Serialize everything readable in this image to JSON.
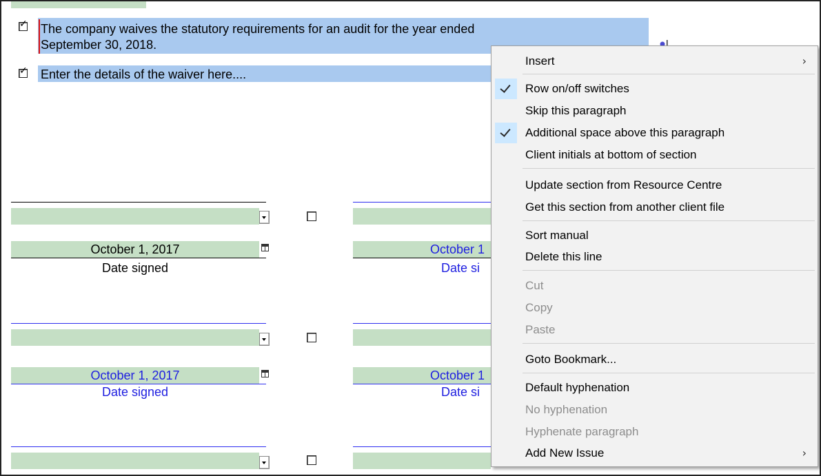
{
  "document": {
    "waiver_paragraph_line1": "The  company  waives  the  statutory  requirements  for  an  audit  for  the  year  ended",
    "waiver_paragraph_line2": "September 30, 2018.",
    "details_paragraph": "Enter the details of the waiver here....",
    "signature_blocks": [
      {
        "date_left": "October 1, 2017",
        "label_left": "Date signed",
        "date_right": "October 1",
        "label_right": "Date si"
      },
      {
        "date_left": "October 1, 2017",
        "label_left": "Date signed",
        "date_right": "October 1",
        "label_right": "Date si"
      }
    ]
  },
  "context_menu": {
    "items": [
      {
        "label": "Insert",
        "checked": false,
        "disabled": false,
        "submenu": true
      },
      {
        "label": "Row on/off switches",
        "checked": true,
        "disabled": false,
        "submenu": false
      },
      {
        "label": "Skip this paragraph",
        "checked": false,
        "disabled": false,
        "submenu": false
      },
      {
        "label": "Additional space above this paragraph",
        "checked": true,
        "disabled": false,
        "submenu": false
      },
      {
        "label": "Client initials at bottom of section",
        "checked": false,
        "disabled": false,
        "submenu": false
      },
      {
        "label": "Update section from Resource Centre",
        "checked": false,
        "disabled": false,
        "submenu": false
      },
      {
        "label": "Get this section from another client file",
        "checked": false,
        "disabled": false,
        "submenu": false
      },
      {
        "label": "Sort manual",
        "checked": false,
        "disabled": false,
        "submenu": false
      },
      {
        "label": "Delete this line",
        "checked": false,
        "disabled": false,
        "submenu": false
      },
      {
        "label": "Cut",
        "checked": false,
        "disabled": true,
        "submenu": false
      },
      {
        "label": "Copy",
        "checked": false,
        "disabled": true,
        "submenu": false
      },
      {
        "label": "Paste",
        "checked": false,
        "disabled": true,
        "submenu": false
      },
      {
        "label": "Goto Bookmark...",
        "checked": false,
        "disabled": false,
        "submenu": false
      },
      {
        "label": "Default hyphenation",
        "checked": false,
        "disabled": false,
        "submenu": false
      },
      {
        "label": "No hyphenation",
        "checked": false,
        "disabled": true,
        "submenu": false
      },
      {
        "label": "Hyphenate paragraph",
        "checked": false,
        "disabled": true,
        "submenu": false
      },
      {
        "label": "Add New Issue",
        "checked": false,
        "disabled": false,
        "submenu": true
      }
    ],
    "submenu_glyph": "›"
  },
  "colors": {
    "highlight": "#a9c9ef",
    "field_green": "#c5dfc5",
    "blue_text": "#1e1ee0",
    "menu_bg": "#f2f2f2",
    "check_bg": "#cce8ff",
    "disabled_text": "#8d8d8d"
  }
}
